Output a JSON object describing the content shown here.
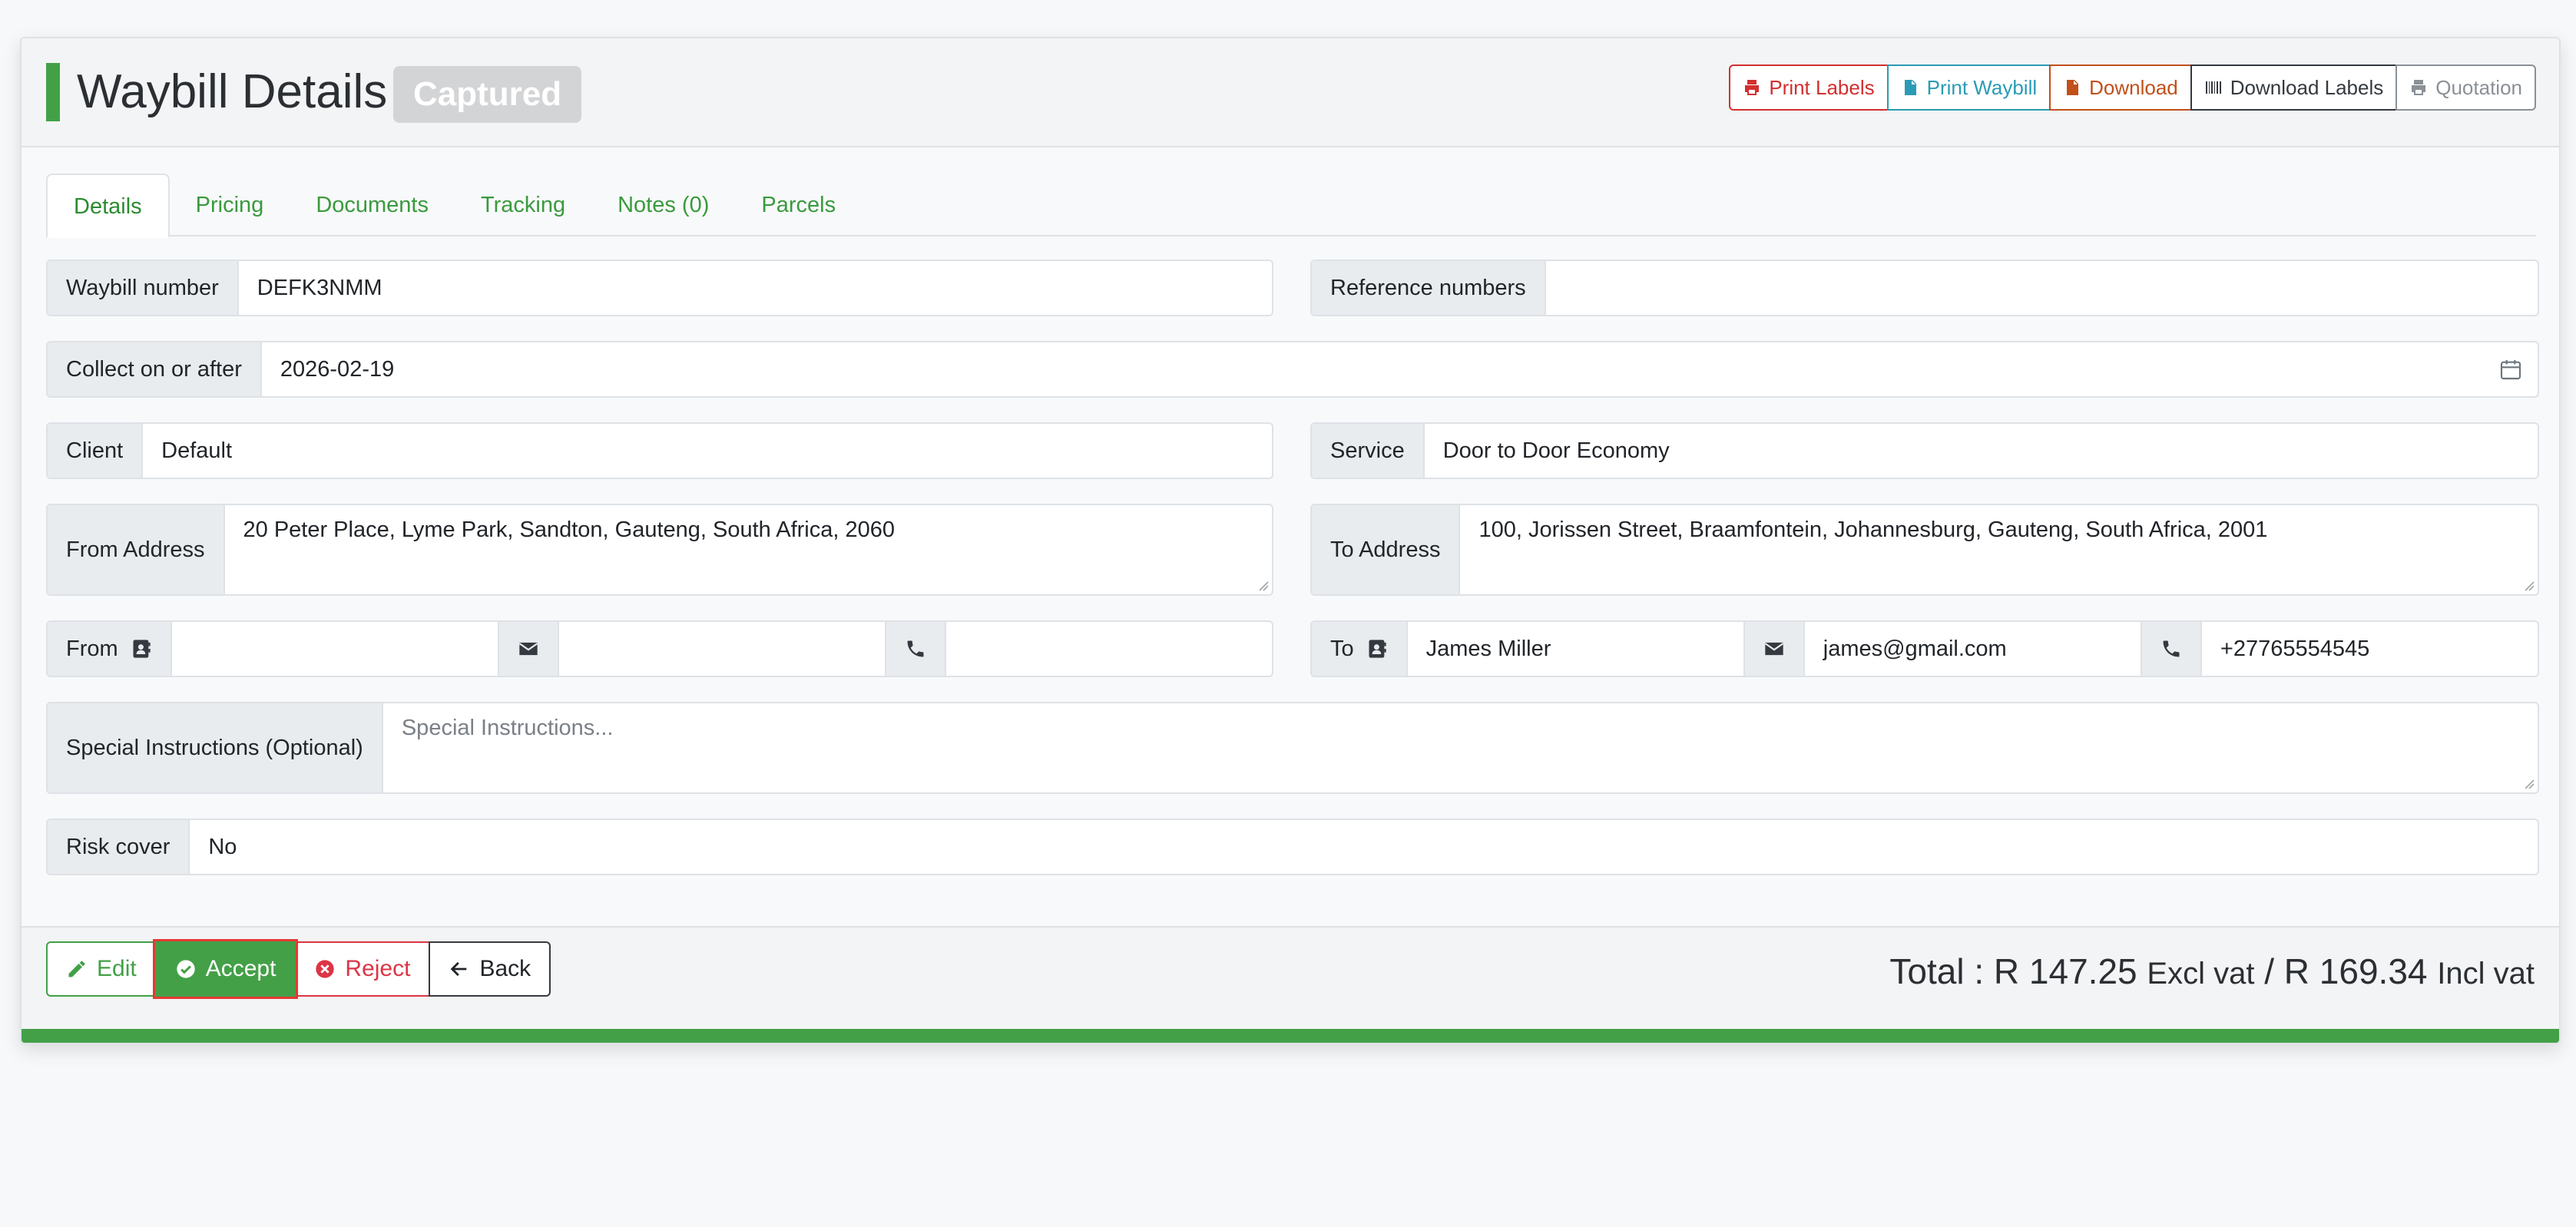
{
  "header": {
    "title": "Waybill Details",
    "status": "Captured",
    "actions": {
      "print_labels": "Print Labels",
      "print_waybill": "Print Waybill",
      "download": "Download",
      "download_labels": "Download Labels",
      "quotation": "Quotation"
    }
  },
  "tabs": [
    "Details",
    "Pricing",
    "Documents",
    "Tracking",
    "Notes (0)",
    "Parcels"
  ],
  "form": {
    "waybill_number": {
      "label": "Waybill number",
      "value": "DEFK3NMM"
    },
    "reference_numbers": {
      "label": "Reference numbers",
      "value": ""
    },
    "collect_on_or_after": {
      "label": "Collect on or after",
      "value": "2026-02-19"
    },
    "client": {
      "label": "Client",
      "value": "Default"
    },
    "service": {
      "label": "Service",
      "value": "Door to Door Economy"
    },
    "from_address": {
      "label": "From Address",
      "value": "20 Peter Place, Lyme Park, Sandton, Gauteng, South Africa, 2060"
    },
    "to_address": {
      "label": "To Address",
      "value": "100, Jorissen Street, Braamfontein, Johannesburg, Gauteng, South Africa, 2001"
    },
    "from_contact": {
      "label": "From",
      "name": "",
      "email": "",
      "phone": ""
    },
    "to_contact": {
      "label": "To",
      "name": "James Miller",
      "email": "james@gmail.com",
      "phone": "+27765554545"
    },
    "special_instructions": {
      "label": "Special Instructions (Optional)",
      "placeholder": "Special Instructions..."
    },
    "risk_cover": {
      "label": "Risk cover",
      "value": "No"
    }
  },
  "footer": {
    "edit": "Edit",
    "accept": "Accept",
    "reject": "Reject",
    "back": "Back",
    "total_prefix": "Total : R 147.25",
    "excl": "Excl vat",
    "sep": "/ R 169.34",
    "incl": "Incl vat"
  },
  "colors": {
    "accent": "#43a047",
    "print_labels": "#d32f2f",
    "print_waybill": "#2a9bb5",
    "download": "#c1501a",
    "download_labels": "#343a40",
    "quotation": "#8a9096",
    "reject": "#dc3545"
  }
}
